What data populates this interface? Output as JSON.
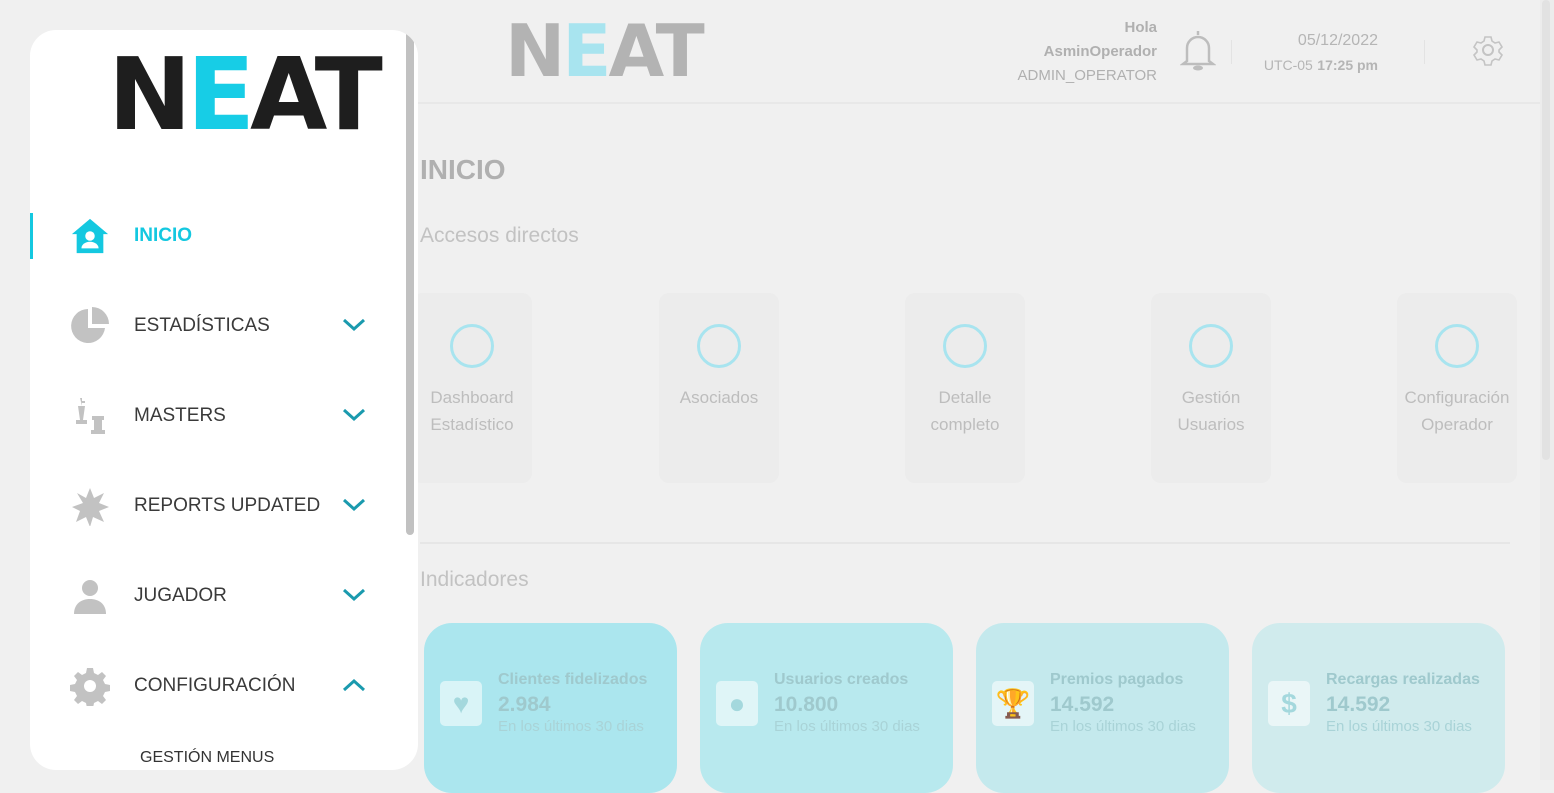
{
  "header": {
    "logo": "NEAT",
    "greeting": "Hola",
    "user_name": "AsminOperador",
    "role": "ADMIN_OPERATOR",
    "date": "05/12/2022",
    "timezone": "UTC-05",
    "time": "17:25 pm"
  },
  "sidebar": {
    "logo": "NEAT",
    "items": [
      {
        "label": "INICIO",
        "icon": "home-user-icon",
        "active": true
      },
      {
        "label": "ESTADÍSTICAS",
        "icon": "pie-chart-icon",
        "chevron": "down"
      },
      {
        "label": "MASTERS",
        "icon": "chess-icon",
        "chevron": "down"
      },
      {
        "label": "REPORTS UPDATED",
        "icon": "burst-icon",
        "chevron": "down"
      },
      {
        "label": "JUGADOR",
        "icon": "user-icon",
        "chevron": "down"
      },
      {
        "label": "CONFIGURACIÓN",
        "icon": "gear-icon",
        "chevron": "up"
      }
    ],
    "subitems": [
      "GESTIÓN MENUS"
    ]
  },
  "main": {
    "title": "INICIO",
    "shortcuts_title": "Accesos directos",
    "shortcuts": [
      {
        "label": "Dashboard Estadístico"
      },
      {
        "label": "Asociados"
      },
      {
        "label": "Detalle completo"
      },
      {
        "label": "Gestión Usuarios"
      },
      {
        "label": "Configuración Operador"
      }
    ],
    "indicators_title": "Indicadores",
    "indicators": [
      {
        "title": "Clientes fidelizados",
        "value": "2.984",
        "subtitle": "En los últimos 30 dias",
        "icon": "heart-icon",
        "color": "#abe6ee"
      },
      {
        "title": "Usuarios creados",
        "value": "10.800",
        "subtitle": "En los últimos 30 dias",
        "icon": "user-icon",
        "color": "#b8e9ee"
      },
      {
        "title": "Premios pagados",
        "value": "14.592",
        "subtitle": "En los últimos 30 dias",
        "icon": "trophy-icon",
        "color": "#c4e9ed"
      },
      {
        "title": "Recargas realizadas",
        "value": "14.592",
        "subtitle": "En los últimos 30 dias",
        "icon": "dollar-icon",
        "color": "#d0ebed"
      }
    ]
  }
}
